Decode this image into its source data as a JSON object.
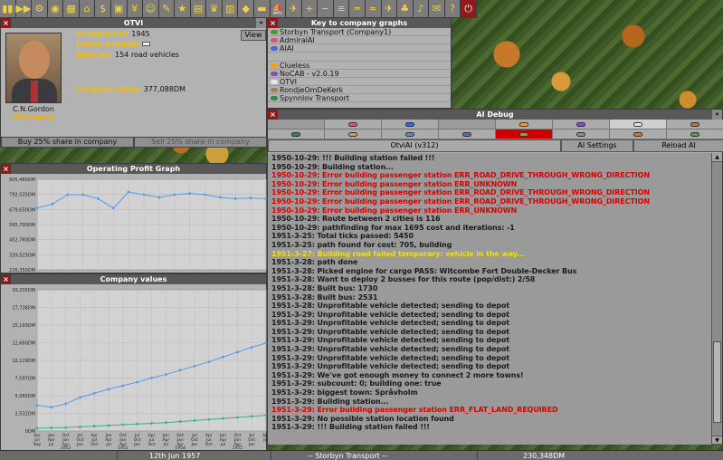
{
  "toolbar": [
    "pause-icon",
    "fast-forward-icon",
    "settings-icon",
    "save-icon",
    "map-icon",
    "town-icon",
    "subsidy-icon",
    "station-icon",
    "finance-icon",
    "company-icon",
    "story-icon",
    "goal-icon",
    "graph-icon",
    "league-icon",
    "industry-icon",
    "train-icon",
    "road-vehicle-icon",
    "ship-icon",
    "aircraft-icon",
    "zoom-in-icon",
    "zoom-out-icon",
    "rail-build-icon",
    "road-build-icon",
    "water-build-icon",
    "airport-build-icon",
    "tree-icon",
    "sound-icon",
    "message-icon",
    "help-icon",
    "quit-icon"
  ],
  "company": {
    "title": "OTVI",
    "manager_name": "C.N.Gordon",
    "manager_role": "(Manager)",
    "inaugurated_label": "Inaugurated:",
    "inaugurated_value": "1945",
    "colour_label": "Colour Scheme:",
    "vehicles_label": "Vehicles:",
    "vehicles_value": "154 road vehicles",
    "value_label": "Company value:",
    "value_value": "377,088DM",
    "view_label": "View",
    "buy_label": "Buy 25% share in company",
    "sell_label": "Sell 25% share in company"
  },
  "key": {
    "title": "Key to company graphs",
    "items": [
      {
        "label": "Storbyn Transport (Company1)",
        "color": "#4a9a2a"
      },
      {
        "label": "AdmiralAI",
        "color": "#d05c7a"
      },
      {
        "label": "AIAI",
        "color": "#3c6ad8"
      },
      {
        "label": "",
        "color": ""
      },
      {
        "label": "Clueless",
        "color": "#f0a020"
      },
      {
        "label": "NoCAB - v2.0.19",
        "color": "#8a4ac8"
      },
      {
        "label": "OTVI",
        "color": "#e8e8e8"
      },
      {
        "label": "RondjeOmDeKerk",
        "color": "#b07a4a"
      },
      {
        "label": "Spynnlov Transport",
        "color": "#2f8a4a"
      }
    ]
  },
  "op_graph": {
    "title": "Operating Profit Graph",
    "chart_data": {
      "type": "line",
      "title": "Operating Profit Graph",
      "yticks": [
        "905,460DM",
        "792,525DM",
        "679,650DM",
        "565,700DM",
        "452,760DM",
        "339,525DM",
        "226,350DM"
      ],
      "ylim": [
        226350,
        905460
      ],
      "series": [
        {
          "color": "#5a9ae8",
          "values": [
            690000,
            720000,
            790000,
            790000,
            760000,
            690000,
            810000,
            790000,
            770000,
            790000,
            800000,
            790000,
            770000,
            760000,
            765000,
            760000
          ]
        }
      ]
    }
  },
  "cv_graph": {
    "title": "Company values",
    "chart_data": {
      "type": "line",
      "title": "Company values",
      "yticks": [
        "20,235DM",
        "17,726DM",
        "15,193DM",
        "12,660DM",
        "10,129DM",
        "7,597DM",
        "5,065DM",
        "2,532DM",
        "0DM"
      ],
      "ylim": [
        0,
        20235
      ],
      "x": [
        "Apr Jul Sep",
        "Jan Apr Jul",
        "Oct Jan Apr",
        "Jul Oct Jan",
        "Apr Jul Oct",
        "Jan Apr Jul",
        "Oct Jan Apr",
        "Jul Oct Jan",
        "Apr Jul Oct",
        "Jan Apr Jul",
        "Oct Jan Apr",
        "Jul Oct Jan",
        "Apr Jul Oct",
        "Jan Apr Jul",
        "Oct Jan Apr",
        "Jul Oct Jan",
        "Apr Jul"
      ],
      "years": [
        "1952",
        "1953",
        "1954",
        "1955",
        "1956"
      ],
      "series": [
        {
          "color": "#5a9ae8",
          "values": [
            3700,
            3400,
            3900,
            4800,
            5400,
            6000,
            6500,
            7000,
            7600,
            8100,
            8700,
            9300,
            9900,
            10600,
            11300,
            12000,
            12600
          ]
        },
        {
          "color": "#3ab08a",
          "values": [
            400,
            450,
            500,
            600,
            700,
            800,
            900,
            1000,
            1100,
            1200,
            1350,
            1500,
            1650,
            1800,
            1950,
            2100,
            2250
          ]
        }
      ]
    }
  },
  "aidebug": {
    "title": "AI Debug",
    "ai_name": "OtviAI (v312)",
    "settings_label": "AI Settings",
    "reload_label": "Reload AI",
    "pills": [
      {
        "color": ""
      },
      {
        "color": "#d05c7a"
      },
      {
        "color": "#3c6ad8"
      },
      {
        "color": ""
      },
      {
        "color": "#f0a020"
      },
      {
        "color": "#8a4ac8"
      },
      {
        "color": "#e8e8e8"
      },
      {
        "color": "#b07a4a"
      },
      {
        "color": "#2f8a4a"
      },
      {
        "color": "#c8a060"
      },
      {
        "color": "#5a8ad0"
      },
      {
        "color": "#4a70b8"
      },
      {
        "color": "#c09020"
      },
      {
        "color": "#7a9a7a"
      },
      {
        "color": "#d07a2a"
      },
      {
        "color": "#4aa050"
      }
    ],
    "log": [
      {
        "t": "1950-10-29: !!! Building station failed !!!",
        "c": "n"
      },
      {
        "t": "1950-10-29: Building station...",
        "c": "n"
      },
      {
        "t": "1950-10-29: Error building passenger station ERR_ROAD_DRIVE_THROUGH_WRONG_DIRECTION",
        "c": "e"
      },
      {
        "t": "1950-10-29: Error building passenger station ERR_UNKNOWN",
        "c": "e"
      },
      {
        "t": "1950-10-29: Error building passenger station ERR_ROAD_DRIVE_THROUGH_WRONG_DIRECTION",
        "c": "e"
      },
      {
        "t": "1950-10-29: Error building passenger station ERR_ROAD_DRIVE_THROUGH_WRONG_DIRECTION",
        "c": "e"
      },
      {
        "t": "1950-10-29: Error building passenger station ERR_UNKNOWN",
        "c": "e"
      },
      {
        "t": "1950-10-29: Route between 2 cities is 116",
        "c": "n"
      },
      {
        "t": "1950-10-29: pathfinding for max 1695 cost and iterations: -1",
        "c": "n"
      },
      {
        "t": "1951-3-25: Total ticks passed: 5450",
        "c": "n"
      },
      {
        "t": "1951-3-25: path found for cost: 705, building",
        "c": "n"
      },
      {
        "t": "1951-3-27: Building road failed temporary: vehicle in the way...",
        "c": "w"
      },
      {
        "t": "1951-3-28: path done",
        "c": "n"
      },
      {
        "t": "1951-3-28: Picked engine for cargo PASS: Witcombe Fort Double-Decker Bus",
        "c": "n"
      },
      {
        "t": "1951-3-28: Want to deploy 2 busses for this route (pop/dist:) 2/58",
        "c": "n"
      },
      {
        "t": "1951-3-28: Built bus: 1730",
        "c": "n"
      },
      {
        "t": "1951-3-28: Built bus: 2531",
        "c": "n"
      },
      {
        "t": "1951-3-28: Unprofitable vehicle detected; sending to depot",
        "c": "n"
      },
      {
        "t": "1951-3-29: Unprofitable vehicle detected; sending to depot",
        "c": "n"
      },
      {
        "t": "1951-3-29: Unprofitable vehicle detected; sending to depot",
        "c": "n"
      },
      {
        "t": "1951-3-29: Unprofitable vehicle detected; sending to depot",
        "c": "n"
      },
      {
        "t": "1951-3-29: Unprofitable vehicle detected; sending to depot",
        "c": "n"
      },
      {
        "t": "1951-3-29: Unprofitable vehicle detected; sending to depot",
        "c": "n"
      },
      {
        "t": "1951-3-29: Unprofitable vehicle detected; sending to depot",
        "c": "n"
      },
      {
        "t": "1951-3-29: Unprofitable vehicle detected; sending to depot",
        "c": "n"
      },
      {
        "t": "1951-3-29: We've got enough money to connect 2 more towns!",
        "c": "n"
      },
      {
        "t": "1951-3-29: subcount: 0; building one: true",
        "c": "n"
      },
      {
        "t": "1951-3-29: biggest town: Språvholm",
        "c": "n"
      },
      {
        "t": "1951-3-29: Building station...",
        "c": "n"
      },
      {
        "t": "1951-3-29: Error building passenger station ERR_FLAT_LAND_REQUIRED",
        "c": "e"
      },
      {
        "t": "1951-3-29: No possible station location found",
        "c": "n"
      },
      {
        "t": "1951-3-29: !!! Building station failed !!!",
        "c": "n"
      }
    ]
  },
  "status": {
    "date": "12th Jun 1957",
    "company": "-- Storbyn Transport --",
    "money": "230,348DM"
  }
}
